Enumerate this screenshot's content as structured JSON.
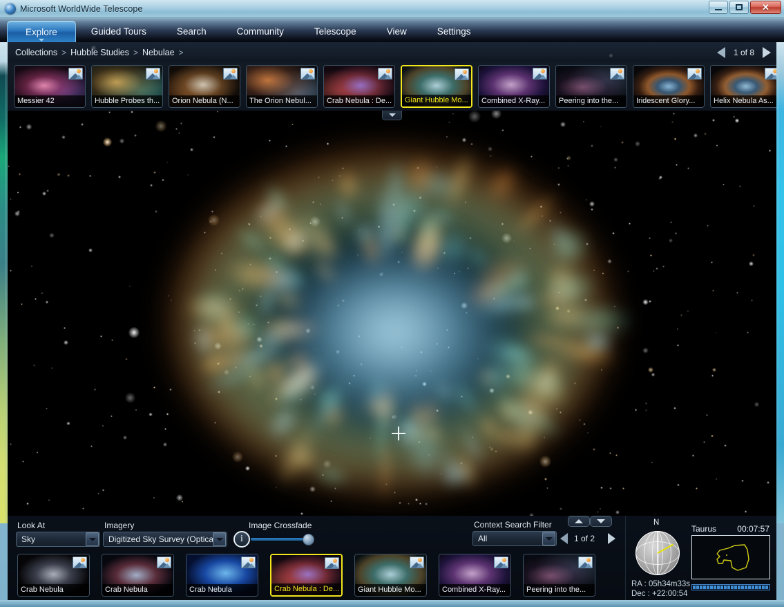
{
  "window": {
    "title": "Microsoft WorldWide Telescope",
    "icon": "wwt-globe-icon",
    "minimize_label": "Minimize",
    "maximize_label": "Restore",
    "close_label": "Close"
  },
  "menu": {
    "items": [
      {
        "label": "Explore",
        "active": true
      },
      {
        "label": "Guided Tours",
        "active": false
      },
      {
        "label": "Search",
        "active": false
      },
      {
        "label": "Community",
        "active": false
      },
      {
        "label": "Telescope",
        "active": false
      },
      {
        "label": "View",
        "active": false
      },
      {
        "label": "Settings",
        "active": false
      }
    ]
  },
  "breadcrumb": {
    "items": [
      "Collections",
      "Hubble Studies",
      "Nebulae"
    ],
    "separator": ">",
    "trailing_separator": ">",
    "pager": {
      "label": "1 of 8",
      "prev_icon": "triangle-left-icon",
      "next_icon": "triangle-right-icon"
    }
  },
  "top_strip": {
    "collapse_icon": "chevron-down-icon",
    "items": [
      {
        "caption": "Messier 42",
        "selected": false,
        "badge": "image-badge-icon"
      },
      {
        "caption": "Hubble Probes th...",
        "selected": false,
        "badge": "image-badge-icon"
      },
      {
        "caption": "Orion Nebula (N...",
        "selected": false,
        "badge": "image-badge-icon"
      },
      {
        "caption": "The Orion Nebul...",
        "selected": false,
        "badge": "image-badge-icon"
      },
      {
        "caption": "Crab Nebula : De...",
        "selected": false,
        "badge": "image-badge-icon"
      },
      {
        "caption": "Giant Hubble Mo...",
        "selected": true,
        "badge": "image-badge-icon"
      },
      {
        "caption": "Combined X-Ray...",
        "selected": false,
        "badge": "image-badge-icon"
      },
      {
        "caption": "Peering into the...",
        "selected": false,
        "badge": "image-badge-icon"
      },
      {
        "caption": "Iridescent Glory...",
        "selected": false,
        "badge": "image-badge-icon"
      },
      {
        "caption": "Helix Nebula As...",
        "selected": false,
        "badge": "image-badge-icon"
      }
    ]
  },
  "sky_view": {
    "object_name": "Crab Nebula",
    "crosshair_icon": "crosshair-icon"
  },
  "controls": {
    "look_at": {
      "label": "Look At",
      "value": "Sky",
      "dropdown_icon": "chevron-down-icon"
    },
    "imagery": {
      "label": "Imagery",
      "value": "Digitized Sky Survey (Optical...",
      "dropdown_icon": "chevron-down-icon"
    },
    "info_button": {
      "label": "i",
      "name": "info-icon"
    },
    "crossfade": {
      "label": "Image Crossfade",
      "value": 100
    },
    "context_filter": {
      "label": "Context Search Filter",
      "value": "All",
      "dropdown_icon": "chevron-down-icon"
    },
    "context_pager": {
      "label": "1 of 2",
      "prev_icon": "triangle-left-icon",
      "next_icon": "triangle-right-icon"
    },
    "nudge_up_icon": "triangle-up-icon",
    "nudge_down_icon": "triangle-down-icon"
  },
  "bottom_strip": {
    "items": [
      {
        "caption": "Crab Nebula",
        "selected": false,
        "badge": "image-badge-icon"
      },
      {
        "caption": "Crab Nebula",
        "selected": false,
        "badge": "image-badge-icon"
      },
      {
        "caption": "Crab Nebula",
        "selected": false,
        "badge": "image-badge-icon"
      },
      {
        "caption": "Crab Nebula : De...",
        "selected": true,
        "badge": "image-badge-icon"
      },
      {
        "caption": "Giant Hubble Mo...",
        "selected": false,
        "badge": "image-badge-icon"
      },
      {
        "caption": "Combined X-Ray...",
        "selected": false,
        "badge": "image-badge-icon"
      },
      {
        "caption": "Peering into the...",
        "selected": false,
        "badge": "image-badge-icon"
      }
    ]
  },
  "orientation": {
    "north_label": "N",
    "ra_label": "RA :",
    "ra_value": "05h34m33s",
    "dec_label": "Dec :",
    "dec_value": "+22:00:54",
    "constellation": "Taurus",
    "time": "00:07:57",
    "progress_percent": 100
  },
  "colors": {
    "selection": "#f2e61c",
    "accent_blue": "#2a76bd",
    "panel_bg": "#0a1019",
    "title_bg": "#a9cfe2"
  }
}
